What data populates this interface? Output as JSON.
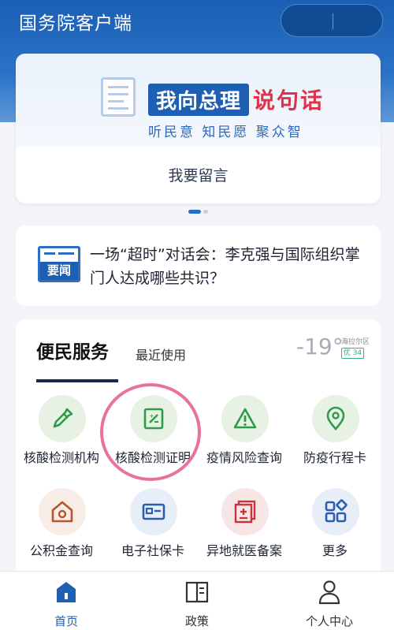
{
  "app": {
    "title": "国务院客户端"
  },
  "banner": {
    "headline_blue": "我向总理",
    "headline_red": "说句话",
    "subtitle": "听民意 知民愿 聚众智",
    "cta": "我要留言",
    "page_indicator": {
      "total": 2,
      "active": 1
    }
  },
  "news": {
    "badge": "要闻",
    "headline": "一场“超时”对话会：李克强与国际组织掌门人达成哪些共识？"
  },
  "services": {
    "title": "便民服务",
    "recent_tab": "最近使用",
    "weather": {
      "temperature": "-19°",
      "location": "海拉尔区",
      "aqi": "优 34"
    },
    "items": [
      {
        "label": "核酸检测机构",
        "icon": "dropper-icon",
        "bg": "#e8f2e4",
        "color": "#2e9a4a"
      },
      {
        "label": "核酸检测证明",
        "icon": "certificate-icon",
        "bg": "#e8f2e4",
        "color": "#2e9a4a"
      },
      {
        "label": "疫情风险查询",
        "icon": "warning-icon",
        "bg": "#e8f2e4",
        "color": "#2e9a4a"
      },
      {
        "label": "防疫行程卡",
        "icon": "location-pin-icon",
        "bg": "#e8f2e4",
        "color": "#2e9a4a"
      },
      {
        "label": "公积金查询",
        "icon": "house-icon",
        "bg": "#f8ece6",
        "color": "#b5552e"
      },
      {
        "label": "电子社保卡",
        "icon": "id-card-icon",
        "bg": "#e7eef8",
        "color": "#2b5fae"
      },
      {
        "label": "异地就医备案",
        "icon": "medical-record-icon",
        "bg": "#f8e6e6",
        "color": "#c5353b"
      },
      {
        "label": "更多",
        "icon": "grid-more-icon",
        "bg": "#e7eef8",
        "color": "#2b5fae"
      }
    ]
  },
  "bottom_nav": {
    "items": [
      {
        "label": "首页",
        "icon": "home-icon",
        "active": true
      },
      {
        "label": "政策",
        "icon": "book-icon",
        "active": false
      },
      {
        "label": "个人中心",
        "icon": "person-icon",
        "active": false
      }
    ]
  },
  "colors": {
    "primary": "#1f5fb3",
    "accent_red": "#d9344a",
    "highlight_ring": "#e9729d"
  }
}
